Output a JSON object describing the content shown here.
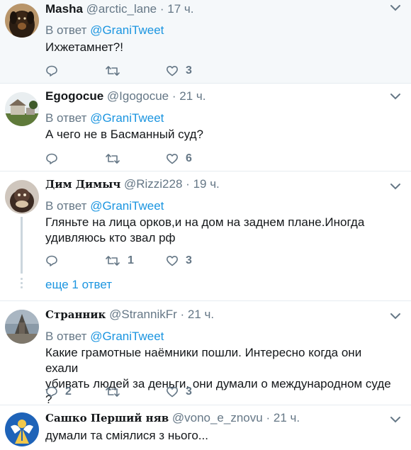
{
  "tweets": [
    {
      "name": "Masha",
      "handle": "@arctic_lane",
      "dot": "·",
      "time": "17 ч.",
      "reply_prefix": "В ответ",
      "reply_to": "@GraniTweet",
      "text": "Ихжетамнет?!",
      "likes": "3"
    },
    {
      "name": "Egogocue",
      "handle": "@Igogocue",
      "dot": "·",
      "time": "21 ч.",
      "reply_prefix": "В ответ",
      "reply_to": "@GraniTweet",
      "text": "А чего не в Басманный суд?",
      "likes": "6"
    },
    {
      "name": "Дим Димыч",
      "handle": "@Rizzi228",
      "dot": "·",
      "time": "19 ч.",
      "reply_prefix": "В ответ",
      "reply_to": "@GraniTweet",
      "text_line1": "Гляньте на лица орков,и на дом на заднем плане.Иногда",
      "text_line2": "удивляюсь кто звал  рф",
      "retweets": "1",
      "likes": "3",
      "more_replies": "еще 1 ответ"
    },
    {
      "name": "Странник",
      "handle": "@StrannikFr",
      "dot": "·",
      "time": "21 ч.",
      "reply_prefix": "В ответ",
      "reply_to": "@GraniTweet",
      "text_line1": "Какие грамотные наёмники пошли. Интересно когда они ехали",
      "text_line2": "убивать людей за деньги, они думали о международном суде ?",
      "replies": "2",
      "likes": "3"
    },
    {
      "name": "Сашко Перший няв",
      "handle": "@vono_e_znovu",
      "dot": "·",
      "time": "21 ч.",
      "text": "думали та сміялися з нього..."
    }
  ],
  "colors": {
    "link": "#1b95e0",
    "secondary": "#657786",
    "divider": "#e6ecf0",
    "first_bg": "#f5f8fa"
  },
  "icons": [
    "reply-icon",
    "retweet-icon",
    "like-icon",
    "chevron-down-icon"
  ]
}
